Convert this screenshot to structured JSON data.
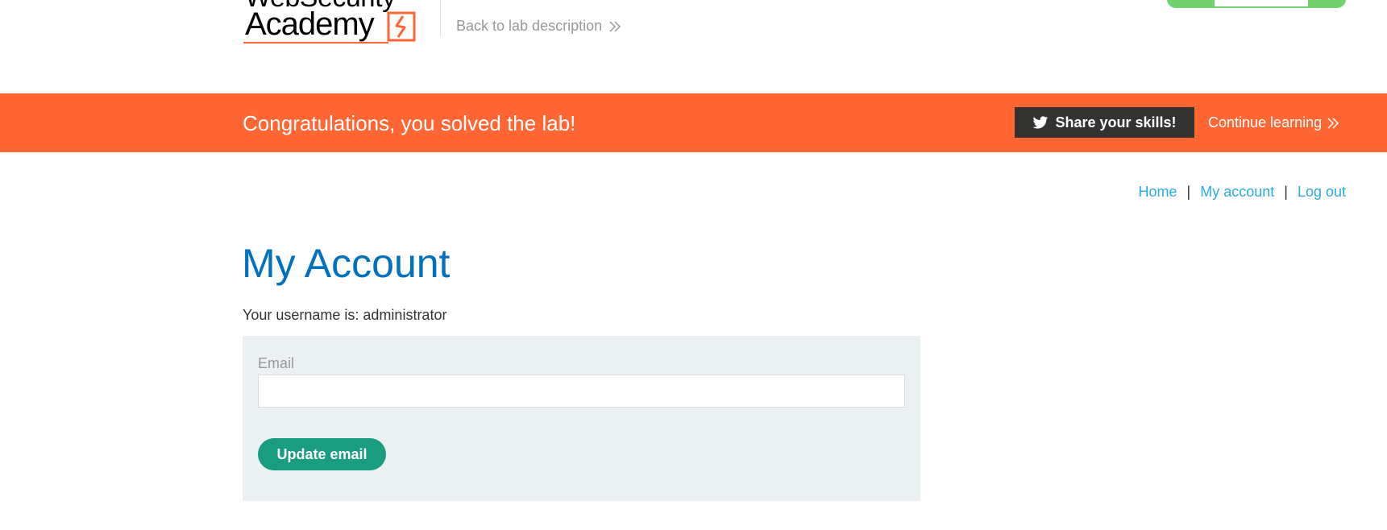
{
  "header": {
    "logo_text_top": "WebSecurity",
    "logo_text_bottom": "Academy",
    "back_link_label": "Back to lab description",
    "back_link_icon": "double-chevron-right-icon"
  },
  "banner": {
    "message": "Congratulations, you solved the lab!",
    "share_label": "Share your skills!",
    "share_icon": "twitter-icon",
    "continue_label": "Continue learning",
    "background_color": "#ff6633"
  },
  "nav": {
    "home": "Home",
    "separator": "|",
    "my_account": "My account",
    "log_out": "Log out"
  },
  "main": {
    "title": "My Account",
    "username_line": "Your username is: administrator",
    "email_label": "Email",
    "email_value": "",
    "update_button_label": "Update email"
  },
  "colors": {
    "accent": "#ff6633",
    "link": "#29abe0",
    "title": "#0071bc",
    "button": "#1a9c80",
    "panel": "#ebf0f2",
    "status_widget": "#70d16d"
  }
}
